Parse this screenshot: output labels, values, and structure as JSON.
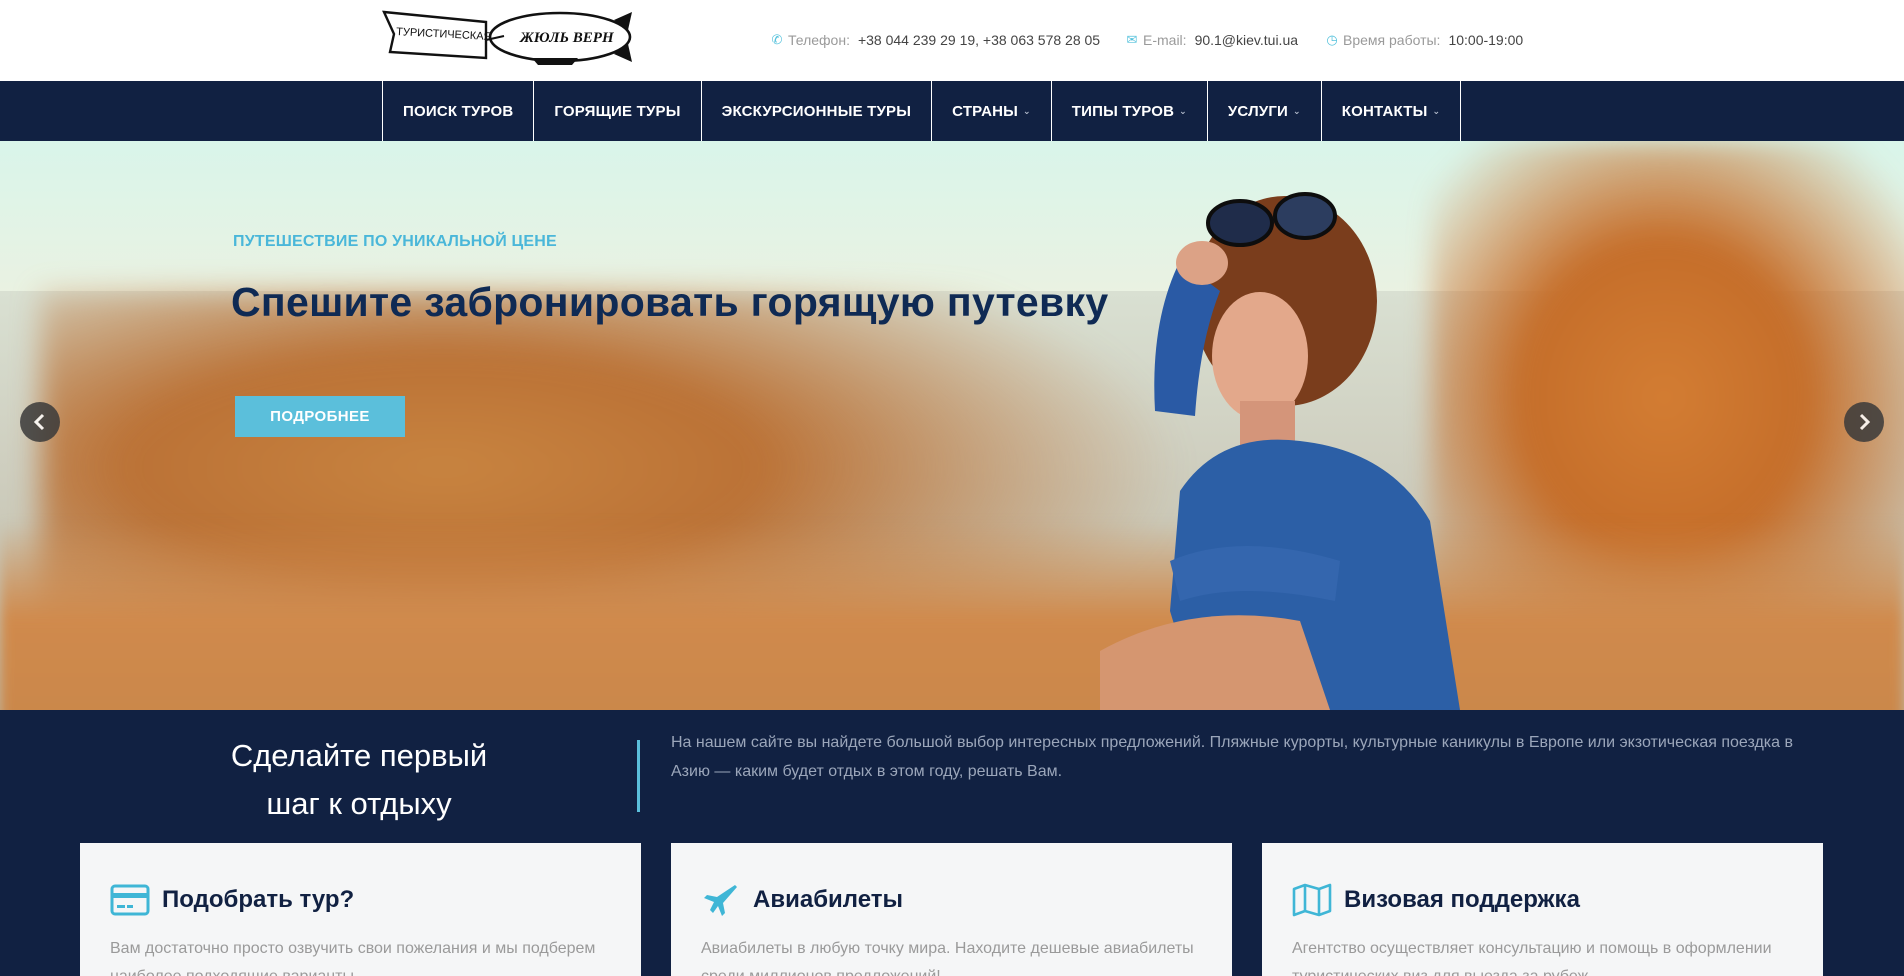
{
  "header": {
    "logo": {
      "text_left": "ТУРИСТИЧЕСКАЯ КОМПАНИЯ",
      "text_right": "ЖЮЛЬ ВЕРН",
      "icon": "airship-logo"
    },
    "phone": {
      "icon": "phone-icon",
      "label": "Телефон:",
      "value": "+38 044 239 29 19, +38 063 578 28 05"
    },
    "email": {
      "icon": "envelope-icon",
      "label": "E-mail:",
      "value": "90.1@kiev.tui.ua"
    },
    "hours": {
      "icon": "clock-icon",
      "label": "Время работы:",
      "value": "10:00-19:00"
    }
  },
  "nav": {
    "items": [
      {
        "label": "ПОИСК ТУРОВ",
        "has_dropdown": false
      },
      {
        "label": "ГОРЯЩИЕ ТУРЫ",
        "has_dropdown": false
      },
      {
        "label": "ЭКСКУРСИОННЫЕ ТУРЫ",
        "has_dropdown": false
      },
      {
        "label": "СТРАНЫ",
        "has_dropdown": true
      },
      {
        "label": "ТИПЫ ТУРОВ",
        "has_dropdown": true
      },
      {
        "label": "УСЛУГИ",
        "has_dropdown": true
      },
      {
        "label": "КОНТАКТЫ",
        "has_dropdown": true
      }
    ]
  },
  "hero": {
    "kicker": "ПУТЕШЕСТВИЕ ПО УНИКАЛЬНОЙ ЦЕНЕ",
    "title": "Спешите забронировать горящую путевку",
    "button": "ПОДРОБНЕЕ",
    "prev_icon": "chevron-left-icon",
    "next_icon": "chevron-right-icon"
  },
  "intro": {
    "title_line1": "Сделайте первый",
    "title_line2": "шаг к отдыху",
    "text": "На нашем сайте вы найдете большой выбор интересных предложений. Пляжные курорты, культурные каникулы в Европе или экзотическая поездка в Азию — каким будет отдых в этом году, решать Вам."
  },
  "cards": [
    {
      "icon": "credit-card-icon",
      "title": "Подобрать тур?",
      "text": "Вам достаточно просто озвучить свои пожелания и мы подберем наиболее подходящие варианты."
    },
    {
      "icon": "airplane-icon",
      "title": "Авиабилеты",
      "text": "Авиабилеты в любую точку мира. Находите дешевые авиабилеты среди миллионов предложений!"
    },
    {
      "icon": "map-icon",
      "title": "Визовая поддержка",
      "text": "Агентство осуществляет консультацию и помощь в оформлении туристических виз для выезда за рубеж."
    }
  ],
  "colors": {
    "navy": "#112142",
    "accent": "#5bbfdb",
    "title_dark": "#0f2a54"
  }
}
